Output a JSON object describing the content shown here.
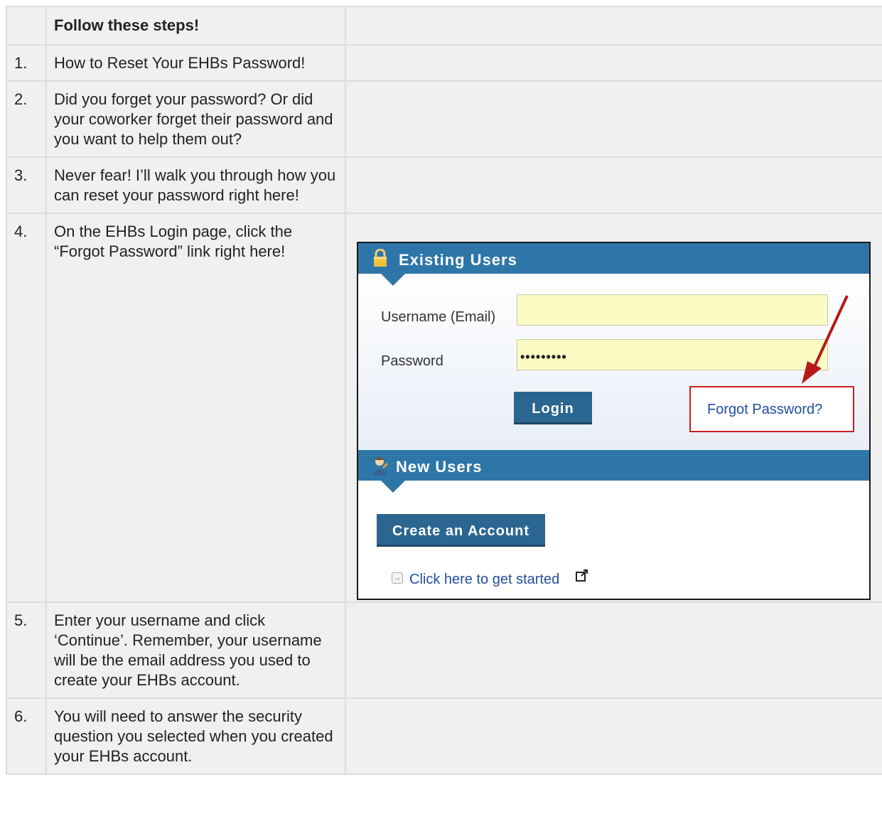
{
  "header": "Follow these steps!",
  "steps": [
    {
      "num": "1.",
      "text": "How to Reset Your EHBs Password!"
    },
    {
      "num": "2.",
      "text": "Did you forget your password? Or did your coworker forget their password and you want to help them out?"
    },
    {
      "num": "3.",
      "text": "Never fear! I’ll walk you through how you can reset your password right here!"
    },
    {
      "num": "4.",
      "text": "On the EHBs Login page, click the “Forgot Password” link right here!"
    },
    {
      "num": "5.",
      "text": "Enter your username and click ‘Continue’. Remember, your username will be the email address you used to create your EHBs account."
    },
    {
      "num": "6.",
      "text": "You will need to answer the security question you selected when you created your EHBs account."
    }
  ],
  "screenshot": {
    "existing_title": "Existing Users",
    "username_label": "Username (Email)",
    "username_value": "",
    "password_label": "Password",
    "password_value": "•••••••••",
    "login_button": "Login",
    "forgot_link": "Forgot Password?",
    "new_title": "New Users",
    "create_button": "Create an Account",
    "started_link": "Click here to get started",
    "icons": [
      "lock-icon",
      "user-icon",
      "arrow-right-icon",
      "external-link-icon",
      "red-arrow-annotation"
    ],
    "colors": {
      "band": "#2e76a8",
      "button": "#2b6690",
      "field": "#fbfbc4",
      "highlight": "#cc1f1f",
      "link": "#1f4f9e"
    }
  }
}
